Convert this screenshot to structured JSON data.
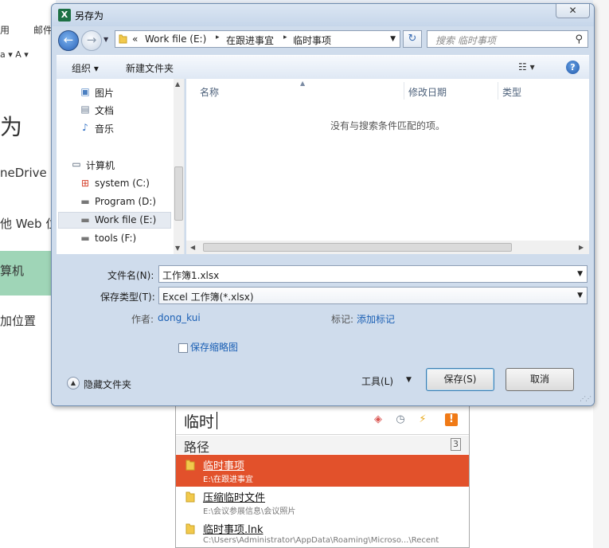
{
  "background": {
    "ribbon_tabs": [
      "用",
      "邮件"
    ],
    "format_row": "a ▾  A ▾",
    "heading": "为",
    "items": [
      "neDrive -",
      "他 Web 位",
      "算机",
      "加位置"
    ]
  },
  "dialog": {
    "title": "另存为",
    "excel_icon": "X",
    "close": "✕",
    "address": {
      "parts": [
        "«",
        "Work file (E:)",
        "▸",
        "在跟进事宜",
        "▸",
        "临时事项"
      ]
    },
    "search_placeholder": "搜索 临时事项",
    "toolbar": {
      "organize": "组织 ▾",
      "new_folder": "新建文件夹",
      "view": "☷ ▾",
      "help": "?"
    },
    "nav": {
      "libraries": [
        {
          "label": "图片",
          "icon": "pictures-icon"
        },
        {
          "label": "文档",
          "icon": "documents-icon"
        },
        {
          "label": "音乐",
          "icon": "music-icon"
        }
      ],
      "computer": "计算机",
      "drives": [
        {
          "label": "system (C:)",
          "icon": "windows-drive-icon"
        },
        {
          "label": "Program (D:)",
          "icon": "drive-icon"
        },
        {
          "label": "Work file (E:)",
          "icon": "drive-icon",
          "selected": true
        },
        {
          "label": "tools (F:)",
          "icon": "drive-icon"
        }
      ]
    },
    "columns": [
      "名称",
      "修改日期",
      "类型"
    ],
    "empty_message": "没有与搜索条件匹配的项。",
    "form": {
      "filename_label": "文件名(N):",
      "filename_value": "工作簿1.xlsx",
      "savetype_label": "保存类型(T):",
      "savetype_value": "Excel 工作簿(*.xlsx)",
      "author_label": "作者:",
      "author_value": "dong_kui",
      "tags_label": "标记:",
      "tags_value": "添加标记",
      "thumbnail_label": "保存缩略图"
    },
    "bottom": {
      "hide_folders": "隐藏文件夹",
      "tools": "工具(L)",
      "save": "保存(S)",
      "cancel": "取消"
    }
  },
  "popup": {
    "query": "临时",
    "section": "路径",
    "count": "3",
    "results": [
      {
        "title": "临时事项",
        "path": "E:\\在跟进事宜",
        "selected": true
      },
      {
        "title": "压缩临时文件",
        "path": "E:\\会议参展信息\\会议照片",
        "selected": false
      },
      {
        "title": "临时事项.lnk",
        "path": "C:\\Users\\Administrator\\AppData\\Roaming\\Microso...\\Recent",
        "selected": false
      }
    ]
  },
  "colors": {
    "selected_result": "#e2512b",
    "dialog_frame": "#cfdcec",
    "link": "#1a5fb4",
    "active_backstage": "#9fd5b7"
  }
}
